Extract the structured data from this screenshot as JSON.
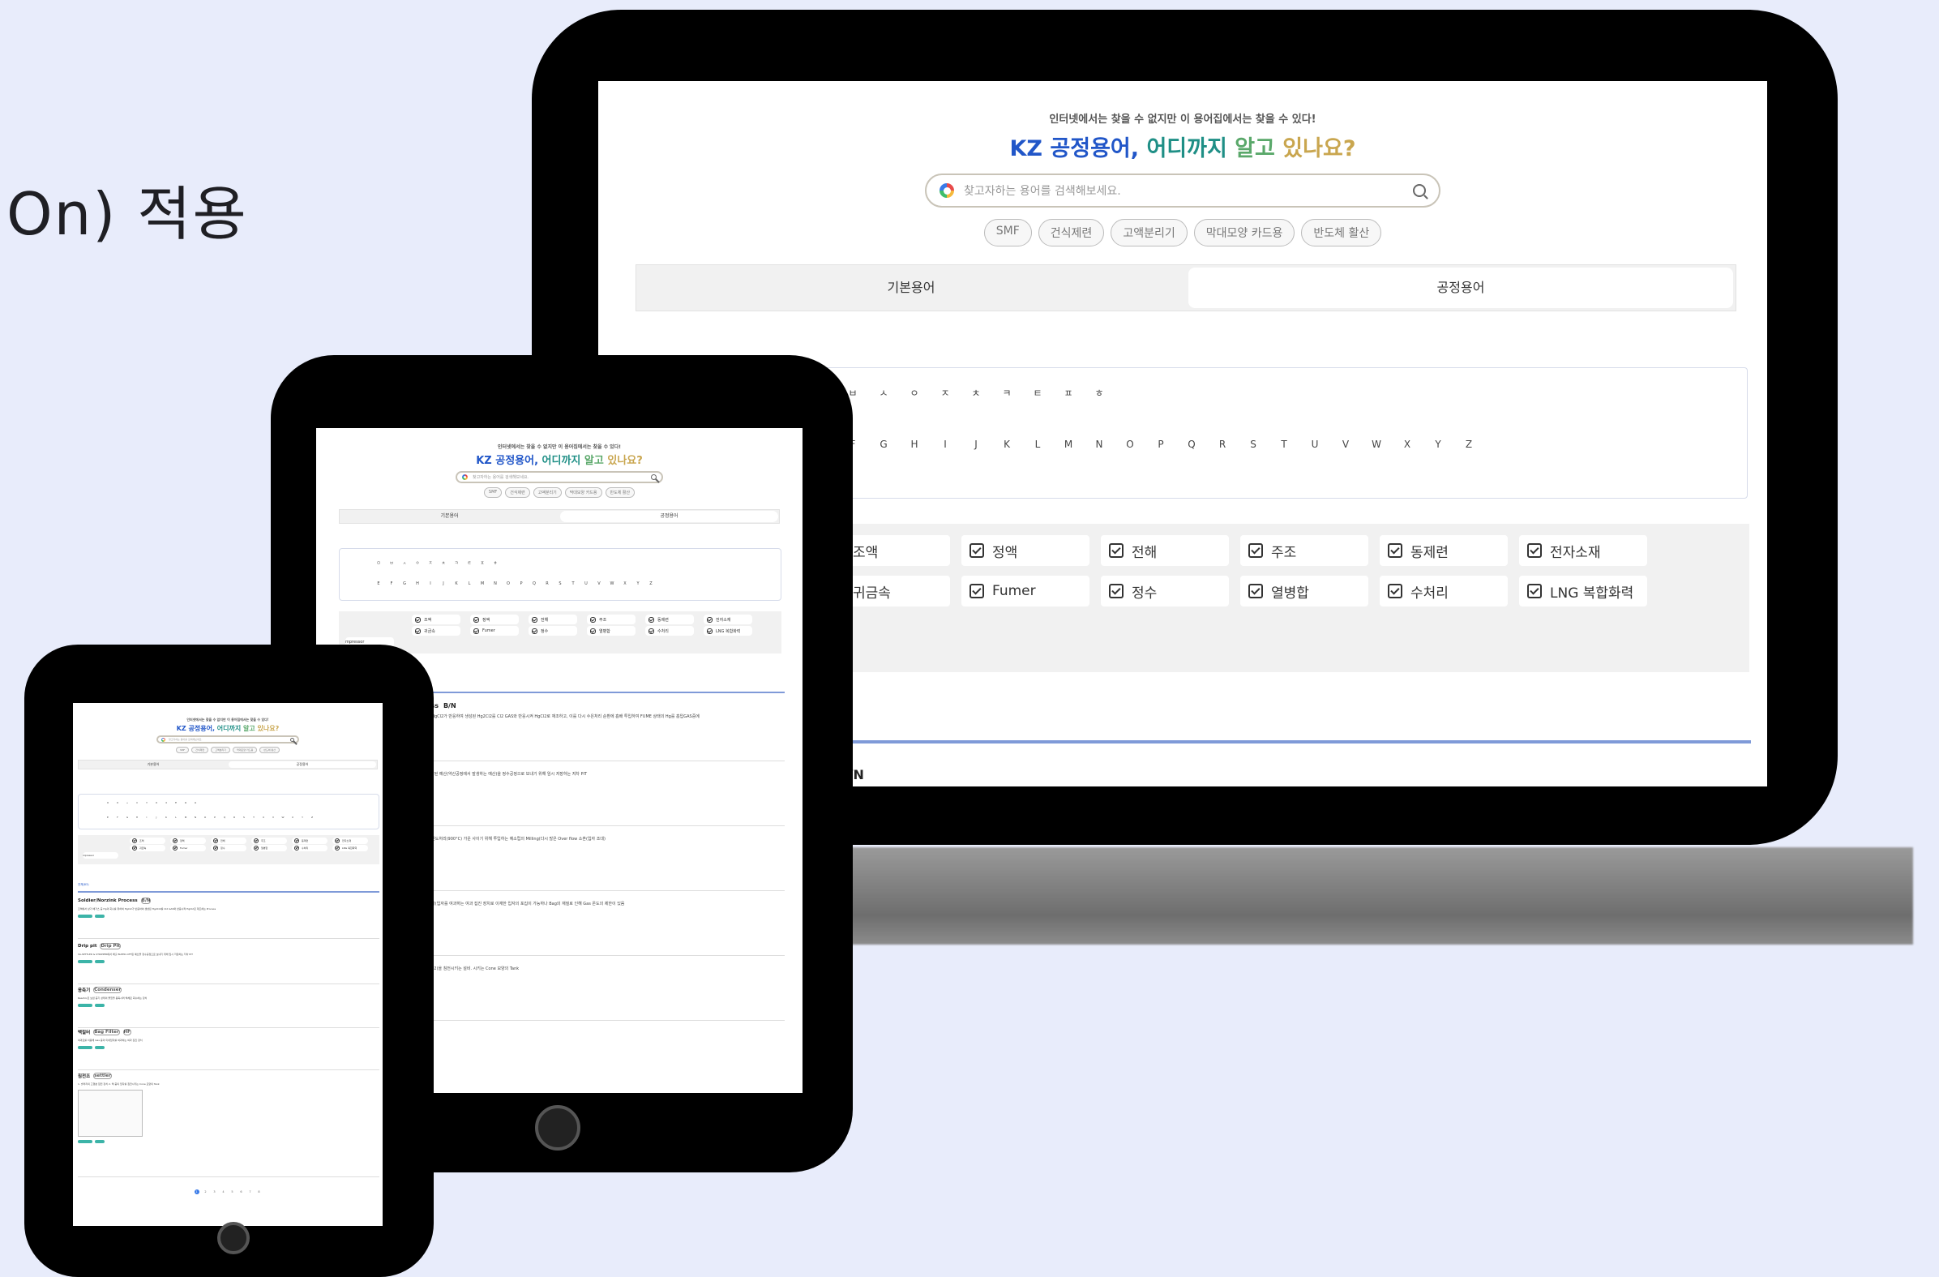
{
  "heading": "On) 적용",
  "site": {
    "tagline": "인터넷에서는 찾을 수 없지만 이 용어집에서는 찾을 수 있다!",
    "title_parts": [
      "KZ ",
      "공정용어, ",
      "어디까지 ",
      "알고 ",
      "있나요?"
    ],
    "search_placeholder": "찾고자하는 용어를 검색해보세요.",
    "chips": [
      "SMF",
      "건식제련",
      "고액분리기",
      "막대모양 카드용",
      "반도체 활산"
    ],
    "tabs": [
      "기본용어",
      "공정용어"
    ],
    "korean_letters": [
      "ㅁ",
      "ㅂ",
      "ㅅ",
      "ㅇ",
      "ㅈ",
      "ㅊ",
      "ㅋ",
      "ㅌ",
      "ㅍ",
      "ㅎ"
    ],
    "english_letters": [
      "E",
      "F",
      "G",
      "H",
      "I",
      "J",
      "K",
      "L",
      "M",
      "N",
      "O",
      "P",
      "Q",
      "R",
      "S",
      "T",
      "U",
      "V",
      "W",
      "X",
      "Y",
      "Z"
    ],
    "categories_row1": [
      "조액",
      "정액",
      "전해",
      "주조",
      "동제련",
      "전자소재"
    ],
    "categories_row2": [
      "귀금속",
      "Fumer",
      "정수",
      "열병합",
      "수처리",
      "LNG 복합화력"
    ],
    "category_partial": "mpressor",
    "process_label": "cess",
    "process_tag": "약",
    "process_bn": "B/N"
  },
  "tablet": {
    "items": [
      {
        "title": "ess",
        "tag": "B/N",
        "desc": "에 HgCl2가 반응하여 생성된 Hg2Cl2를 Cl2 GAS와 반응시켜 HgCl2로 재조하고, 이를 다시 수은처리 순환에 흡배 투입하여 FUME 상태의 Hg를 흡입GAS중에"
      },
      {
        "title": "",
        "tag": "",
        "desc": "OFF된 예산(약산공정에서 발생하는 예산)을 정수공정으로 보내기 위해 임시 저장하는 저차 PIT"
      },
      {
        "title": "",
        "tag": "",
        "desc": "는 온도처리(900°C) 가운 사이기 위해 투입하는 예소립의 Milling(다시 많은 Over flow 소혼(입자 조대)"
      },
      {
        "title": "",
        "tag": "",
        "desc": "이 바(입자를 여과하는 여과 집진 장치로 이재한 입자의 포집이 가능하나 Bag의 재질로 인해 Gas 온도의 제한이 있음"
      },
      {
        "title": "",
        "tag": "",
        "desc": "(CO2)을 침전시키는 설비. 시키는 Cone 모양의 Tank"
      }
    ]
  },
  "phone": {
    "section_label": "전체(83)",
    "items": [
      {
        "title": "Soldier/Norzink Process",
        "tag": "B/N",
        "desc": "조액에서 상기 배가스 중 Hg의 회수를 위하여 HgCl2가 반응하여 생성된 Hg2Cl2를 Cl2 GAS와 반응시켜 HgCl2로 재조하는 Process"
      },
      {
        "title": "Drip pit",
        "tag": "Drip Pit",
        "desc": "VA-SETTLER & STRIPPER에서 배출 BLEED-OFF된 예산을 정수공정으로 보내기 위해 임시 저장하는 저차 PIT"
      },
      {
        "title": "응축기",
        "tag": "Condenser",
        "desc": "Reactor로 보낸 증기 상태의 물질을 응축시켜 액체로 회수하는 장치"
      },
      {
        "title": "백필터",
        "tag": "Bag Filter",
        "desc": "여과포를 이용해 Gas 중의 미세입자를 여과하는 여과 집진 장치"
      },
      {
        "title": "침전조",
        "tag": "settler",
        "desc": "1. 슬러리의 고형분 침전 장치 2. 액 중의 입자를 침전시키는 Cone 모양의 Tank"
      }
    ],
    "tag_extra": "HF",
    "pages": [
      "1",
      "2",
      "3",
      "4",
      "5",
      "6",
      "7",
      "8"
    ]
  }
}
